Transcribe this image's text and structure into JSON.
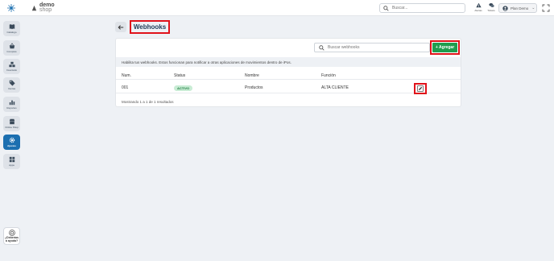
{
  "brand": {
    "line1": "demo",
    "line2": "shop"
  },
  "topbar": {
    "search_placeholder": "Buscar...",
    "alerts_label": "Alertas",
    "tickets_label": "Tickets",
    "user_name": "Plan Demo"
  },
  "sidebar": {
    "items": [
      {
        "label": "Catálogo",
        "icon": "book-icon"
      },
      {
        "label": "Compras",
        "icon": "basket-icon"
      },
      {
        "label": "Inventario",
        "icon": "boxes-icon"
      },
      {
        "label": "Ventas",
        "icon": "tag-icon"
      },
      {
        "label": "Reportes",
        "icon": "bar-chart-icon"
      },
      {
        "label": "Online Shop",
        "icon": "shop-icon"
      },
      {
        "label": "Ajustes",
        "icon": "gear-icon"
      },
      {
        "label": "Apps",
        "icon": "apps-icon"
      }
    ],
    "active_index": 6,
    "help_label_1": "¿Deberías",
    "help_label_2": "a ayuda?"
  },
  "page": {
    "title": "Webhooks",
    "search_placeholder": "Buscar webhooks",
    "add_label": "+ Agregar",
    "info_text": "Habilita tus webhooks. Estos funcionan para notificar a otras aplicaciones de movimientos dentro de iPos."
  },
  "table": {
    "headers": [
      "Num.",
      "Status",
      "Nombre",
      "Función"
    ],
    "rows": [
      {
        "num": "001",
        "status": "ACTIVO",
        "name": "Productos",
        "function": "ALTA CLIENTE"
      }
    ],
    "footer": "Mostrando 1 a 1 de 1 resultados"
  },
  "colors": {
    "accent": "#1b6fb0",
    "add_button": "#1f9d4e",
    "highlight": "#e0131b",
    "status_active_bg": "#c8ecd4"
  }
}
